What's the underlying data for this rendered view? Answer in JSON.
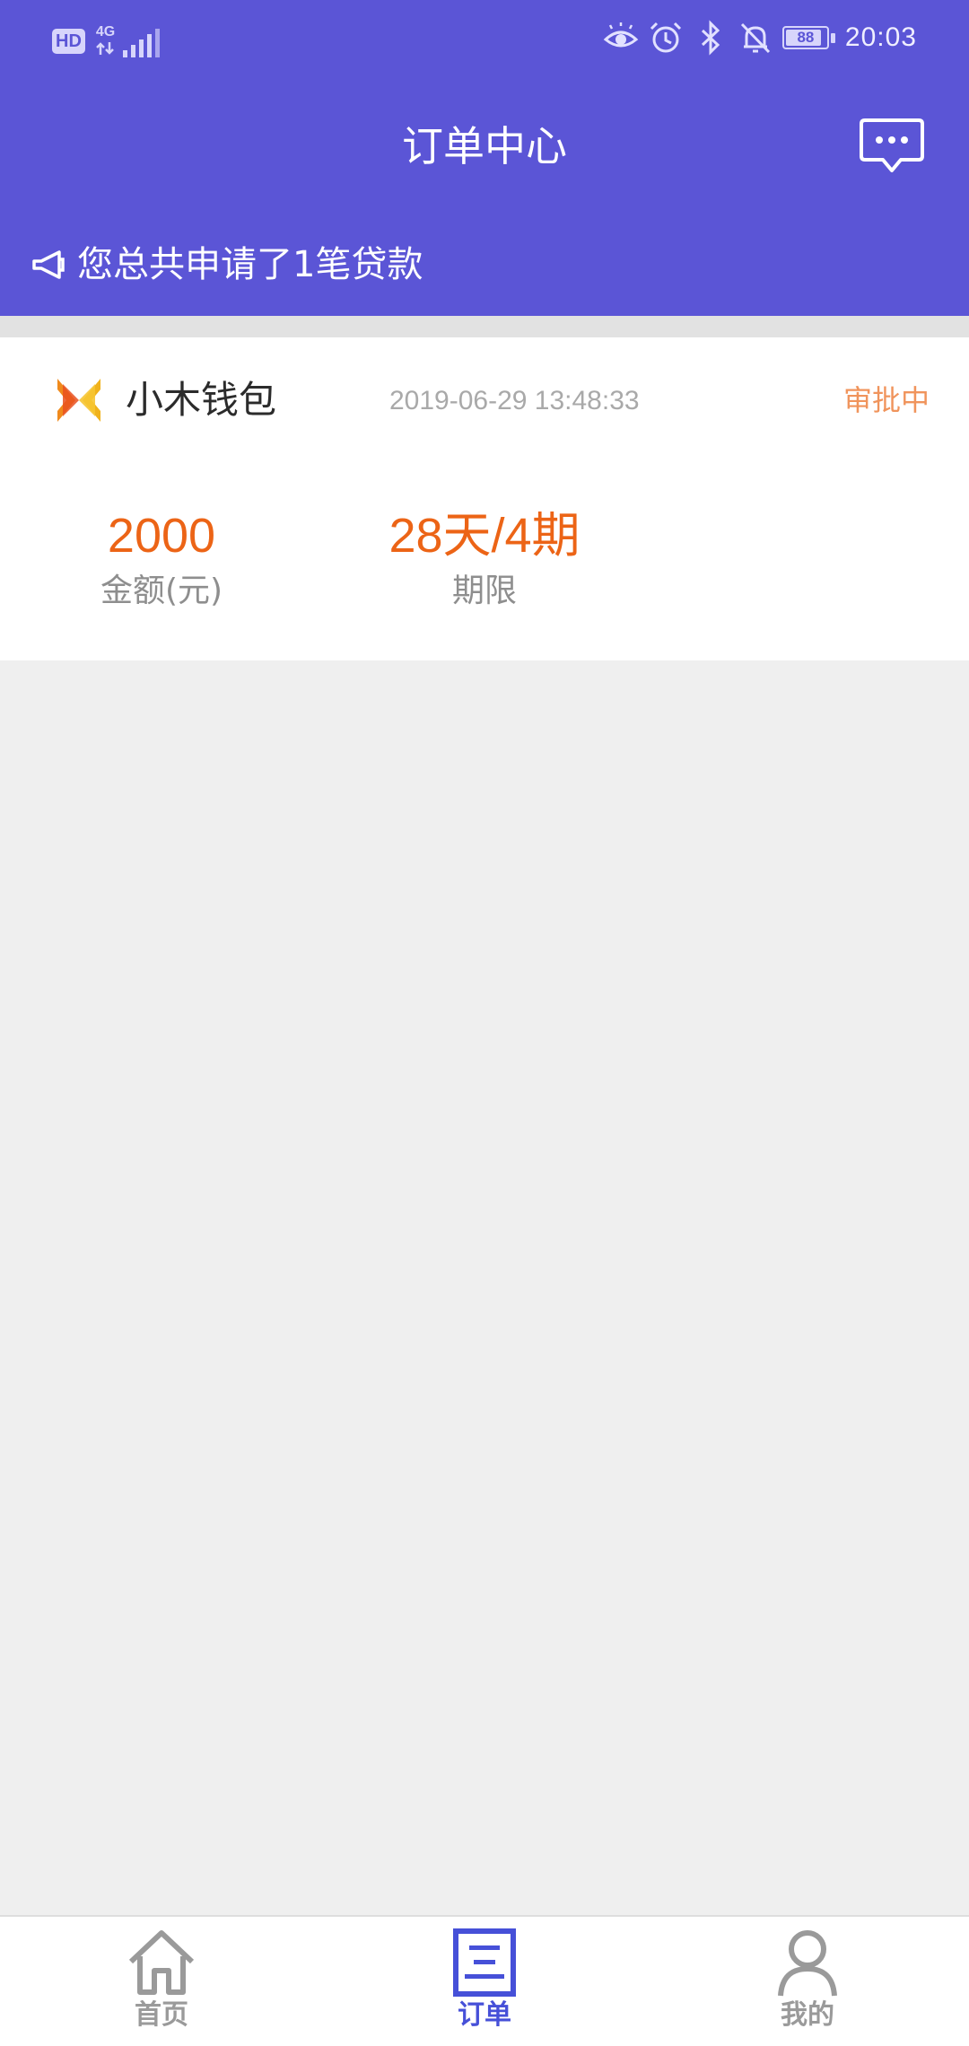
{
  "status_bar": {
    "hd": "HD",
    "network": "4G",
    "battery": "88",
    "battery_level": 0.88,
    "time": "20:03",
    "icons": [
      "eye-comfort-icon",
      "alarm-icon",
      "bluetooth-icon",
      "mute-bell-icon"
    ]
  },
  "header": {
    "title": "订单中心",
    "message_icon": "message-bubble-icon",
    "notice_icon": "megaphone-icon",
    "notice": "您总共申请了1笔贷款"
  },
  "orders": [
    {
      "brand": "小木钱包",
      "logo_icon": "brand-logo-icon",
      "time": "2019-06-29 13:48:33",
      "status": "审批中",
      "amount": "2000",
      "amount_label": "金额(元)",
      "term": "28天/4期",
      "term_label": "期限"
    }
  ],
  "nav": {
    "items": [
      {
        "label": "首页",
        "icon": "home-icon",
        "active": false
      },
      {
        "label": "订单",
        "icon": "order-icon",
        "active": true
      },
      {
        "label": "我的",
        "icon": "person-icon",
        "active": false
      }
    ]
  },
  "colors": {
    "primary": "#5b55d6",
    "accent_orange": "#ec6416",
    "status_orange": "#f0945c",
    "nav_active": "#4650d8",
    "nav_inactive": "#9a9a9a",
    "background": "#efefef"
  }
}
